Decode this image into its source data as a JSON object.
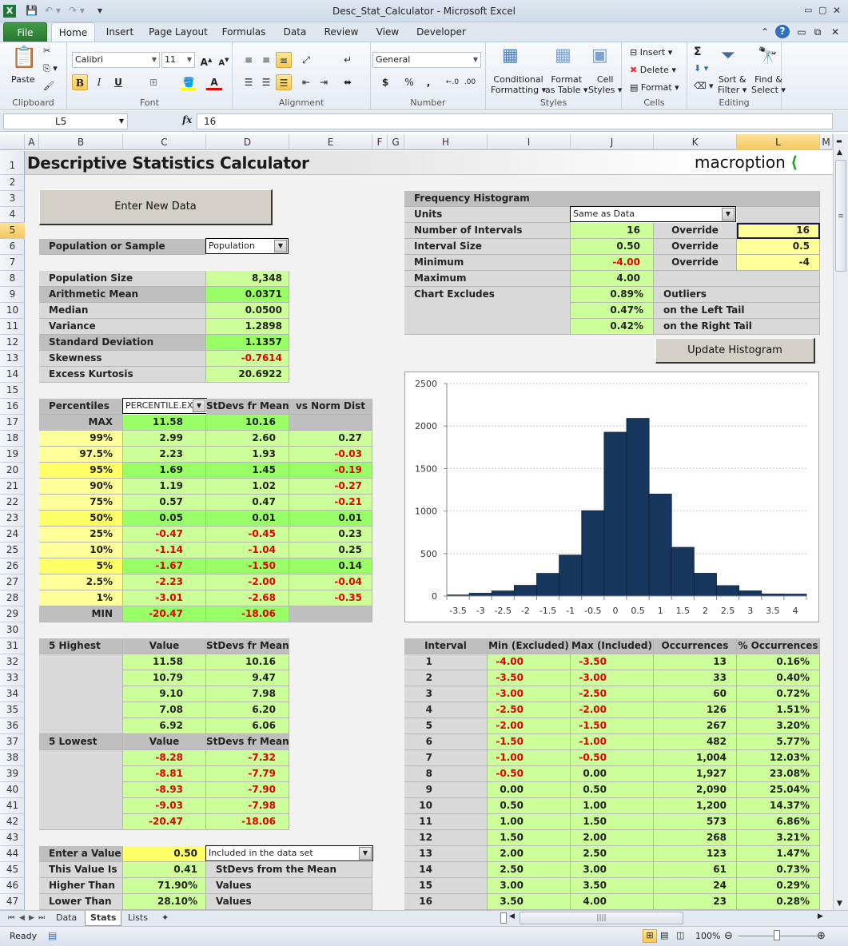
{
  "window": {
    "title": "Desc_Stat_Calculator  -  Microsoft Excel",
    "controls": [
      "minimize",
      "restore",
      "close"
    ]
  },
  "ribbon_tabs": [
    "File",
    "Home",
    "Insert",
    "Page Layout",
    "Formulas",
    "Data",
    "Review",
    "View",
    "Developer"
  ],
  "active_tab": "Home",
  "ribbon": {
    "clipboard": {
      "label": "Clipboard",
      "paste": "Paste"
    },
    "font": {
      "label": "Font",
      "name": "Calibri",
      "size": "11",
      "bold": "B",
      "italic": "I",
      "underline": "U"
    },
    "alignment": {
      "label": "Alignment"
    },
    "number": {
      "label": "Number",
      "format": "General",
      "currency": "$",
      "percent": "%",
      "comma": ","
    },
    "styles": {
      "label": "Styles",
      "conditional": [
        "Conditional",
        "Formatting ▾"
      ],
      "format_table": [
        "Format",
        "as Table ▾"
      ],
      "cell_styles": [
        "Cell",
        "Styles ▾"
      ]
    },
    "cells": {
      "label": "Cells",
      "insert": "Insert ▾",
      "delete": "Delete ▾",
      "format": "Format ▾"
    },
    "editing": {
      "label": "Editing",
      "sum": "Σ",
      "sort": [
        "Sort &",
        "Filter ▾"
      ],
      "find": [
        "Find &",
        "Select ▾"
      ]
    }
  },
  "formula_bar": {
    "name_box": "L5",
    "fx": "fx",
    "value": "16"
  },
  "columns": [
    "A",
    "B",
    "C",
    "D",
    "E",
    "F",
    "G",
    "H",
    "I",
    "J",
    "K",
    "L",
    "M"
  ],
  "selected_column": "L",
  "selected_row": 5,
  "rows": [
    1,
    2,
    3,
    4,
    5,
    6,
    7,
    8,
    9,
    10,
    11,
    12,
    13,
    14,
    15,
    16,
    17,
    18,
    19,
    20,
    21,
    22,
    23,
    24,
    25,
    26,
    27,
    28,
    29,
    30,
    31,
    32,
    33,
    34,
    35,
    36,
    37,
    38,
    39,
    40,
    41,
    42,
    43,
    44,
    45,
    46,
    47
  ],
  "sheet": {
    "title": "Descriptive Statistics Calculator",
    "logo": "macroption",
    "enter_new_data": "Enter New Data",
    "population_or_sample": {
      "label": "Population or Sample",
      "value": "Population"
    },
    "summary": [
      {
        "label": "Population Size",
        "value": "8,348",
        "hl": false,
        "neg": false
      },
      {
        "label": "Arithmetic Mean",
        "value": "0.0371",
        "hl": true,
        "neg": false
      },
      {
        "label": "Median",
        "value": "0.0500",
        "hl": false,
        "neg": false
      },
      {
        "label": "Variance",
        "value": "1.2898",
        "hl": false,
        "neg": false
      },
      {
        "label": "Standard Deviation",
        "value": "1.1357",
        "hl": true,
        "neg": false
      },
      {
        "label": "Skewness",
        "value": "-0.7614",
        "hl": false,
        "neg": true
      },
      {
        "label": "Excess Kurtosis",
        "value": "20.6922",
        "hl": false,
        "neg": false
      }
    ],
    "percentiles": {
      "header": "Percentiles",
      "function": "PERCENTILE.EXC",
      "col_stdev": "StDevs fr Mean",
      "col_norm": "vs Norm Dist",
      "rows": [
        {
          "p": "MAX",
          "value": "11.58",
          "stdev": "10.16",
          "norm": ""
        },
        {
          "p": "99%",
          "value": "2.99",
          "stdev": "2.60",
          "norm": "0.27"
        },
        {
          "p": "97.5%",
          "value": "2.23",
          "stdev": "1.93",
          "norm": "-0.03"
        },
        {
          "p": "95%",
          "value": "1.69",
          "stdev": "1.45",
          "norm": "-0.19"
        },
        {
          "p": "90%",
          "value": "1.19",
          "stdev": "1.02",
          "norm": "-0.27"
        },
        {
          "p": "75%",
          "value": "0.57",
          "stdev": "0.47",
          "norm": "-0.21"
        },
        {
          "p": "50%",
          "value": "0.05",
          "stdev": "0.01",
          "norm": "0.01"
        },
        {
          "p": "25%",
          "value": "-0.47",
          "stdev": "-0.45",
          "norm": "0.23"
        },
        {
          "p": "10%",
          "value": "-1.14",
          "stdev": "-1.04",
          "norm": "0.25"
        },
        {
          "p": "5%",
          "value": "-1.67",
          "stdev": "-1.50",
          "norm": "0.14"
        },
        {
          "p": "2.5%",
          "value": "-2.23",
          "stdev": "-2.00",
          "norm": "-0.04"
        },
        {
          "p": "1%",
          "value": "-3.01",
          "stdev": "-2.68",
          "norm": "-0.35"
        },
        {
          "p": "MIN",
          "value": "-20.47",
          "stdev": "-18.06",
          "norm": ""
        }
      ]
    },
    "highest": {
      "header": "5 Highest",
      "col_value": "Value",
      "col_stdev": "StDevs fr Mean",
      "rows": [
        [
          "11.58",
          "10.16"
        ],
        [
          "10.79",
          "9.47"
        ],
        [
          "9.10",
          "7.98"
        ],
        [
          "7.08",
          "6.20"
        ],
        [
          "6.92",
          "6.06"
        ]
      ]
    },
    "lowest": {
      "header": "5 Lowest",
      "col_value": "Value",
      "col_stdev": "StDevs fr Mean",
      "rows": [
        [
          "-8.28",
          "-7.32"
        ],
        [
          "-8.81",
          "-7.79"
        ],
        [
          "-8.93",
          "-7.90"
        ],
        [
          "-9.03",
          "-7.98"
        ],
        [
          "-20.47",
          "-18.06"
        ]
      ]
    },
    "value_check": {
      "enter_label": "Enter a Value",
      "enter_value": "0.50",
      "mode": "Included in the data set",
      "rows": [
        {
          "label": "This Value Is",
          "value": "0.41",
          "desc": "StDevs from the Mean"
        },
        {
          "label": "Higher Than",
          "value": "71.90%",
          "desc": "Values"
        },
        {
          "label": "Lower Than",
          "value": "28.10%",
          "desc": "Values"
        }
      ]
    },
    "histogram_settings": {
      "header": "Frequency Histogram",
      "units_label": "Units",
      "units_value": "Same as Data",
      "override_label": "Override",
      "rows": [
        {
          "label": "Number of Intervals",
          "value": "16",
          "override": "16",
          "neg": false
        },
        {
          "label": "Interval Size",
          "value": "0.50",
          "override": "0.5",
          "neg": false
        },
        {
          "label": "Minimum",
          "value": "-4.00",
          "override": "-4",
          "neg": true
        },
        {
          "label": "Maximum",
          "value": "4.00",
          "override": null,
          "neg": false
        }
      ],
      "excludes_label": "Chart Excludes",
      "excludes": [
        {
          "value": "0.89%",
          "desc": "Outliers"
        },
        {
          "value": "0.47%",
          "desc": "on the Left Tail"
        },
        {
          "value": "0.42%",
          "desc": "on the Right Tail"
        }
      ],
      "update_button": "Update Histogram"
    },
    "intervals": {
      "headers": [
        "Interval",
        "Min (Excluded)",
        "Max (Included)",
        "Occurrences",
        "% Occurrences"
      ],
      "rows": [
        [
          "1",
          "-4.00",
          "-3.50",
          "13",
          "0.16%"
        ],
        [
          "2",
          "-3.50",
          "-3.00",
          "33",
          "0.40%"
        ],
        [
          "3",
          "-3.00",
          "-2.50",
          "60",
          "0.72%"
        ],
        [
          "4",
          "-2.50",
          "-2.00",
          "126",
          "1.51%"
        ],
        [
          "5",
          "-2.00",
          "-1.50",
          "267",
          "3.20%"
        ],
        [
          "6",
          "-1.50",
          "-1.00",
          "482",
          "5.77%"
        ],
        [
          "7",
          "-1.00",
          "-0.50",
          "1,004",
          "12.03%"
        ],
        [
          "8",
          "-0.50",
          "0.00",
          "1,927",
          "23.08%"
        ],
        [
          "9",
          "0.00",
          "0.50",
          "2,090",
          "25.04%"
        ],
        [
          "10",
          "0.50",
          "1.00",
          "1,200",
          "14.37%"
        ],
        [
          "11",
          "1.00",
          "1.50",
          "573",
          "6.86%"
        ],
        [
          "12",
          "1.50",
          "2.00",
          "268",
          "3.21%"
        ],
        [
          "13",
          "2.00",
          "2.50",
          "123",
          "1.47%"
        ],
        [
          "14",
          "2.50",
          "3.00",
          "61",
          "0.73%"
        ],
        [
          "15",
          "3.00",
          "3.50",
          "24",
          "0.29%"
        ],
        [
          "16",
          "3.50",
          "4.00",
          "23",
          "0.28%"
        ]
      ]
    }
  },
  "chart_data": {
    "type": "bar",
    "title": "",
    "xlabel": "",
    "ylabel": "",
    "categories": [
      "-3.5",
      "-3",
      "-2.5",
      "-2",
      "-1.5",
      "-1",
      "-0.5",
      "0",
      "0.5",
      "1",
      "1.5",
      "2",
      "2.5",
      "3",
      "3.5",
      "4"
    ],
    "values": [
      13,
      33,
      60,
      126,
      267,
      482,
      1004,
      1927,
      2090,
      1200,
      573,
      268,
      123,
      61,
      24,
      23
    ],
    "ylim": [
      0,
      2500
    ],
    "yticks": [
      0,
      500,
      1000,
      1500,
      2000,
      2500
    ],
    "grid": true,
    "legend": "none",
    "bar_color": "#17365d"
  },
  "sheet_tabs": [
    "Data",
    "Stats",
    "Lists"
  ],
  "active_sheet": "Stats",
  "status": {
    "text": "Ready",
    "zoom": "100%"
  }
}
